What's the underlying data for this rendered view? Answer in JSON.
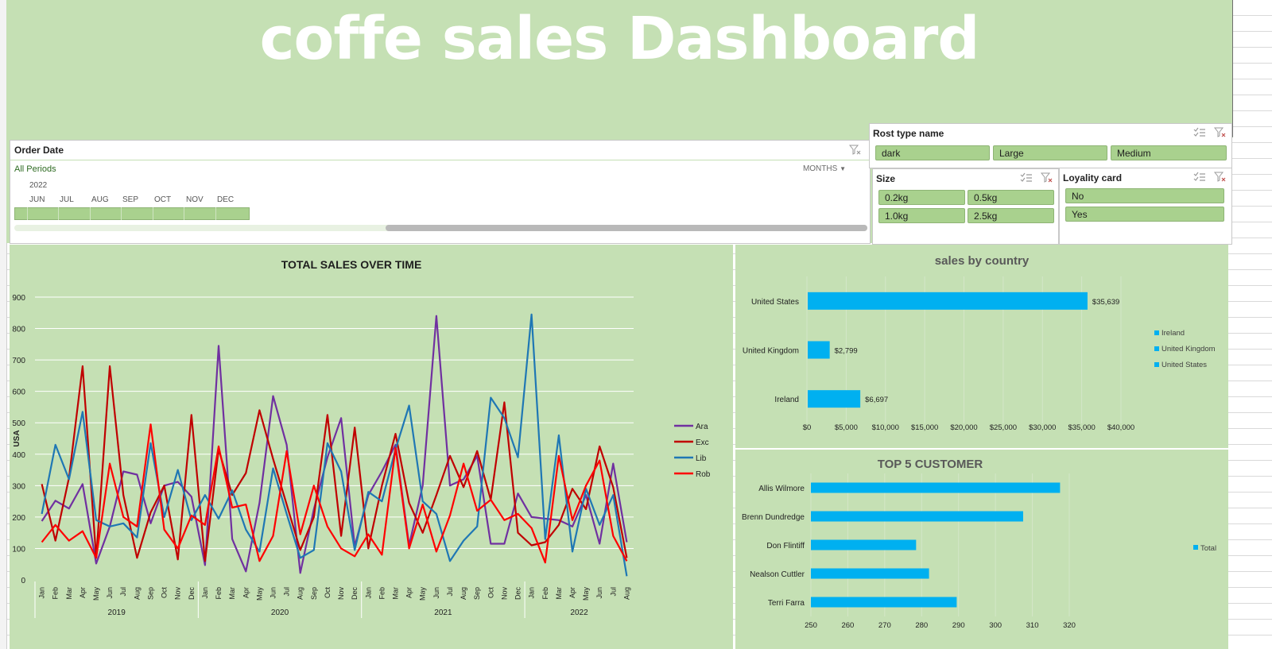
{
  "banner": {
    "title": "coffe sales  Dashboard"
  },
  "timeline": {
    "header": "Order Date",
    "all_periods": "All Periods",
    "level": "MONTHS",
    "year": "2022",
    "months": [
      "JUN",
      "JUL",
      "AUG",
      "SEP",
      "OCT",
      "NOV",
      "DEC"
    ]
  },
  "roast_slicer": {
    "header": "Rost type name",
    "items": [
      "dark",
      "Large",
      "Medium"
    ]
  },
  "size_slicer": {
    "header": "Size",
    "items": [
      "0.2kg",
      "0.5kg",
      "1.0kg",
      "2.5kg"
    ]
  },
  "loyalty_slicer": {
    "header": "Loyality card",
    "items": [
      "No",
      "Yes"
    ]
  },
  "colors": {
    "banner_bg": "#c5e0b4",
    "pill": "#a9d18e",
    "bar": "#00b0f0",
    "ara": "#7030a0",
    "exc": "#c00000",
    "lib": "#1f77b4",
    "rob": "#ff0000"
  },
  "chart_data": [
    {
      "type": "line",
      "title": "TOTAL SALES OVER TIME",
      "ylabel": "USA",
      "ylim": [
        0,
        900
      ],
      "yticks": [
        "0",
        "100",
        "200",
        "300",
        "400",
        "500",
        "600",
        "700",
        "800",
        "900"
      ],
      "grid": true,
      "legend": "right",
      "x_months": [
        "Jan",
        "Feb",
        "Mar",
        "Apr",
        "May",
        "Jun",
        "Jul",
        "Aug",
        "Sep",
        "Oct",
        "Nov",
        "Dec",
        "Jan",
        "Feb",
        "Mar",
        "Apr",
        "May",
        "Jun",
        "Jul",
        "Aug",
        "Sep",
        "Oct",
        "Nov",
        "Dec",
        "Jan",
        "Feb",
        "Mar",
        "Apr",
        "May",
        "Jun",
        "Jul",
        "Aug",
        "Sep",
        "Oct",
        "Nov",
        "Dec",
        "Jan",
        "Feb",
        "Mar",
        "Apr",
        "May",
        "Jun",
        "Jul",
        "Aug"
      ],
      "x_years": [
        "2019",
        "2020",
        "2021",
        "2022"
      ],
      "series": [
        {
          "name": "Ara",
          "values": [
            187,
            252,
            227,
            305,
            52,
            170,
            345,
            335,
            180,
            300,
            312,
            265,
            47,
            745,
            130,
            27,
            245,
            585,
            430,
            22,
            225,
            390,
            515,
            107,
            270,
            345,
            430,
            110,
            300,
            840,
            300,
            320,
            395,
            115,
            115,
            275,
            200,
            195,
            190,
            170,
            270,
            115,
            370,
            120
          ]
        },
        {
          "name": "Exc",
          "values": [
            305,
            125,
            325,
            680,
            70,
            680,
            270,
            70,
            215,
            300,
            65,
            525,
            60,
            415,
            270,
            340,
            540,
            385,
            240,
            95,
            200,
            525,
            140,
            485,
            100,
            300,
            465,
            245,
            150,
            270,
            395,
            295,
            410,
            255,
            565,
            150,
            110,
            120,
            175,
            290,
            225,
            425,
            295,
            70
          ]
        },
        {
          "name": "Lib",
          "values": [
            210,
            430,
            320,
            535,
            190,
            170,
            180,
            135,
            435,
            200,
            350,
            190,
            270,
            195,
            285,
            160,
            90,
            355,
            210,
            70,
            95,
            435,
            345,
            95,
            280,
            250,
            415,
            555,
            250,
            210,
            60,
            125,
            170,
            580,
            515,
            390,
            845,
            130,
            460,
            90,
            290,
            175,
            270,
            12
          ]
        },
        {
          "name": "Rob",
          "values": [
            120,
            175,
            125,
            155,
            70,
            370,
            200,
            170,
            495,
            160,
            100,
            205,
            175,
            425,
            230,
            240,
            60,
            140,
            410,
            145,
            300,
            170,
            100,
            75,
            145,
            80,
            420,
            100,
            240,
            90,
            205,
            370,
            220,
            255,
            190,
            210,
            165,
            55,
            395,
            190,
            300,
            380,
            140,
            60
          ]
        }
      ]
    },
    {
      "type": "bar",
      "title": "sales by country",
      "categories": [
        "United States",
        "United Kingdom",
        "Ireland"
      ],
      "values": [
        35639,
        2799,
        6697
      ],
      "value_labels": [
        "$35,639",
        "$2,799",
        "$6,697"
      ],
      "xlim": [
        0,
        40000
      ],
      "xticks": [
        "$0",
        "$5,000",
        "$10,000",
        "$15,000",
        "$20,000",
        "$25,000",
        "$30,000",
        "$35,000",
        "$40,000"
      ],
      "legend_entries": [
        "Ireland",
        "United Kingdom",
        "United States"
      ],
      "legend": "right"
    },
    {
      "type": "bar",
      "title": "TOP 5 CUSTOMER",
      "categories": [
        "Allis Wilmore",
        "Brenn Dundredge",
        "Don Flintiff",
        "Nealson Cuttler",
        "Terri Farra"
      ],
      "values": [
        317.5,
        307.5,
        278.5,
        282,
        289.5
      ],
      "xlim": [
        250,
        320
      ],
      "xticks": [
        "250",
        "260",
        "270",
        "280",
        "290",
        "300",
        "310",
        "320"
      ],
      "series": [
        {
          "name": "Total"
        }
      ],
      "legend": "right"
    }
  ]
}
